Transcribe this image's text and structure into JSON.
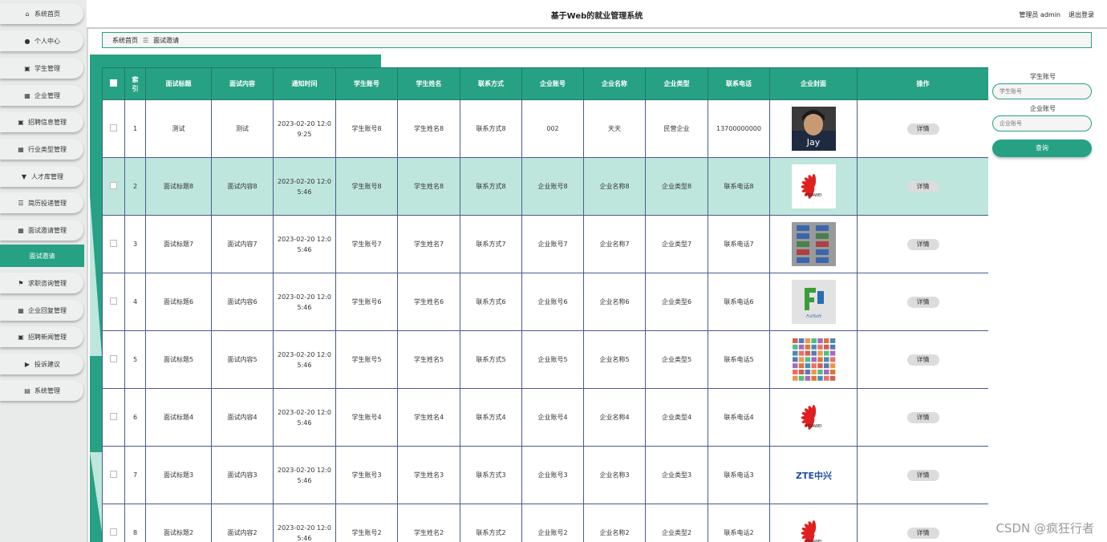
{
  "sidebar": {
    "items": [
      {
        "label": "系统首页",
        "icon": "home-icon",
        "glyph": "⌂"
      },
      {
        "label": "个人中心",
        "icon": "user-icon",
        "glyph": "●"
      },
      {
        "label": "学生管理",
        "icon": "clipboard-icon",
        "glyph": "▣"
      },
      {
        "label": "企业管理",
        "icon": "grid-icon",
        "glyph": "▦"
      },
      {
        "label": "招聘信息管理",
        "icon": "clipboard-icon",
        "glyph": "▣"
      },
      {
        "label": "行业类型管理",
        "icon": "grid-icon",
        "glyph": "▦"
      },
      {
        "label": "人才库管理",
        "icon": "pin-icon",
        "glyph": "▼"
      },
      {
        "label": "简历投递管理",
        "icon": "list-icon",
        "glyph": "☰"
      },
      {
        "label": "面试邀请管理",
        "icon": "grid-icon",
        "glyph": "▦"
      },
      {
        "label": "面试邀请",
        "icon": "",
        "glyph": "",
        "active": true
      },
      {
        "label": "求职咨询管理",
        "icon": "flag-icon",
        "glyph": "⚑"
      },
      {
        "label": "企业回复管理",
        "icon": "grid-icon",
        "glyph": "▦"
      },
      {
        "label": "招聘新闻管理",
        "icon": "clipboard-icon",
        "glyph": "▣"
      },
      {
        "label": "投诉建议",
        "icon": "video-icon",
        "glyph": "▶"
      },
      {
        "label": "系统管理",
        "icon": "database-icon",
        "glyph": "▤"
      }
    ]
  },
  "header": {
    "title": "基于Web的就业管理系统",
    "user": "管理员 admin",
    "logout": "退出登录"
  },
  "breadcrumb": {
    "home": "系统首页",
    "sep": "☰",
    "current": "面试邀请"
  },
  "table": {
    "columns": [
      "",
      "索引",
      "面试标题",
      "面试内容",
      "通知时间",
      "学生账号",
      "学生姓名",
      "联系方式",
      "企业账号",
      "企业名称",
      "企业类型",
      "联系电话",
      "企业封面",
      "操作"
    ],
    "detail_label": "详情",
    "rows": [
      {
        "index": "1",
        "title": "测试",
        "content": "测试",
        "time": "2023-02-20 12:09:25",
        "student_account": "学生账号8",
        "student_name": "学生姓名8",
        "contact": "联系方式8",
        "company_account": "002",
        "company_name": "天天",
        "company_type": "民营企业",
        "phone": "13700000000",
        "cover": "photo-person"
      },
      {
        "index": "2",
        "title": "面试标题8",
        "content": "面试内容8",
        "time": "2023-02-20 12:05:46",
        "student_account": "学生账号8",
        "student_name": "学生姓名8",
        "contact": "联系方式8",
        "company_account": "企业账号8",
        "company_name": "企业名称8",
        "company_type": "企业类型8",
        "phone": "联系电话8",
        "cover": "huawei-logo",
        "highlight": true
      },
      {
        "index": "3",
        "title": "面试标题7",
        "content": "面试内容7",
        "time": "2023-02-20 12:05:46",
        "student_account": "学生账号7",
        "student_name": "学生姓名7",
        "contact": "联系方式7",
        "company_account": "企业账号7",
        "company_name": "企业名称7",
        "company_type": "企业类型7",
        "phone": "联系电话7",
        "cover": "logo-collage"
      },
      {
        "index": "4",
        "title": "面试标题6",
        "content": "面试内容6",
        "time": "2023-02-20 12:05:46",
        "student_account": "学生账号6",
        "student_name": "学生姓名6",
        "contact": "联系方式6",
        "company_account": "企业账号6",
        "company_name": "企业名称6",
        "company_type": "企业类型6",
        "phone": "联系电话6",
        "cover": "fullsoft-logo"
      },
      {
        "index": "5",
        "title": "面试标题5",
        "content": "面试内容5",
        "time": "2023-02-20 12:05:46",
        "student_account": "学生账号5",
        "student_name": "学生姓名5",
        "contact": "联系方式5",
        "company_account": "企业账号5",
        "company_name": "企业名称5",
        "company_type": "企业类型5",
        "phone": "联系电话5",
        "cover": "brand-wall"
      },
      {
        "index": "6",
        "title": "面试标题4",
        "content": "面试内容4",
        "time": "2023-02-20 12:05:46",
        "student_account": "学生账号4",
        "student_name": "学生姓名4",
        "contact": "联系方式4",
        "company_account": "企业账号4",
        "company_name": "企业名称4",
        "company_type": "企业类型4",
        "phone": "联系电话4",
        "cover": "huawei-logo"
      },
      {
        "index": "7",
        "title": "面试标题3",
        "content": "面试内容3",
        "time": "2023-02-20 12:05:46",
        "student_account": "学生账号3",
        "student_name": "学生姓名3",
        "contact": "联系方式3",
        "company_account": "企业账号3",
        "company_name": "企业名称3",
        "company_type": "企业类型3",
        "phone": "联系电话3",
        "cover": "zte-logo"
      },
      {
        "index": "8",
        "title": "面试标题2",
        "content": "面试内容2",
        "time": "2023-02-20 12:05:46",
        "student_account": "学生账号2",
        "student_name": "学生姓名2",
        "contact": "联系方式2",
        "company_account": "企业账号2",
        "company_name": "企业名称2",
        "company_type": "企业类型2",
        "phone": "联系电话2",
        "cover": "huawei-logo"
      }
    ]
  },
  "search": {
    "student_label": "学生账号",
    "student_placeholder": "学生账号",
    "company_label": "企业账号",
    "company_placeholder": "企业账号",
    "button": "查询"
  },
  "cover_art": {
    "photo_text": "Jay",
    "huawei_text": "HUAWEI",
    "zte_text": "ZTE中兴",
    "fullsoft_text": "FullSoft"
  },
  "colors": {
    "accent": "#27a183",
    "highlight_row": "#bfe6dc",
    "huawei_red": "#e02020",
    "zte_blue": "#1d4fa3"
  },
  "watermark": "CSDN @疯狂行者"
}
